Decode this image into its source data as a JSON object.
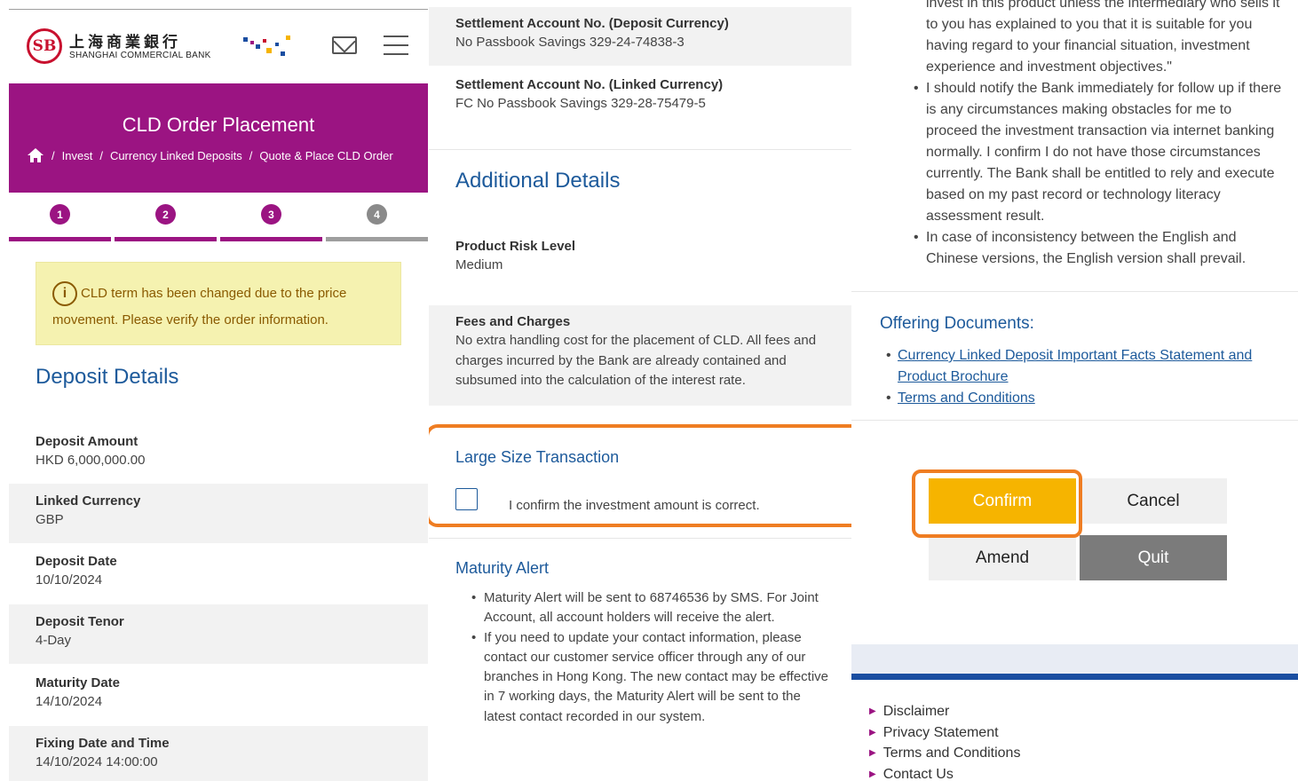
{
  "panel1": {
    "logo": {
      "seal": "SB",
      "chinese": "上海商業銀行",
      "english": "SHANGHAI COMMERCIAL BANK"
    },
    "banner": {
      "title": "CLD Order Placement"
    },
    "breadcrumb": [
      "Invest",
      "Currency Linked Deposits",
      "Quote & Place CLD Order"
    ],
    "steps": [
      "1",
      "2",
      "3",
      "4"
    ],
    "alert": {
      "text": "CLD term has been changed due to the price movement. Please verify the order information."
    },
    "section_title": "Deposit Details",
    "details": [
      {
        "label": "Deposit Amount",
        "value": "HKD  6,000,000.00"
      },
      {
        "label": "Linked Currency",
        "value": "GBP"
      },
      {
        "label": "Deposit Date",
        "value": "10/10/2024"
      },
      {
        "label": "Deposit Tenor",
        "value": "4-Day"
      },
      {
        "label": "Maturity Date",
        "value": "14/10/2024"
      },
      {
        "label": "Fixing Date and Time",
        "value": "14/10/2024 14:00:00"
      }
    ]
  },
  "panel2": {
    "settlement": [
      {
        "label": "Settlement Account No. (Deposit Currency)",
        "value": "No Passbook Savings 329-24-74838-3"
      },
      {
        "label": "Settlement Account No. (Linked Currency)",
        "value": "FC No Passbook Savings 329-28-75479-5"
      }
    ],
    "section_title": "Additional Details",
    "risk": {
      "label": "Product Risk Level",
      "value": "Medium"
    },
    "fees": {
      "label": "Fees and Charges",
      "value": "No extra handling cost for the placement of CLD. All fees and charges incurred by the Bank are already contained and subsumed into the calculation of the interest rate."
    },
    "large": {
      "title": "Large Size Transaction",
      "checkbox_label": "I confirm the investment amount is correct."
    },
    "maturity": {
      "title": "Maturity Alert",
      "items": [
        "Maturity Alert will be sent to 68746536 by SMS. For Joint Account, all account holders will receive the alert.",
        "If you need to update your contact information, please contact our customer service officer through any of our branches in Hong Kong. The new contact may be effective in 7 working days, the Maturity Alert will be sent to the latest contact recorded in our system."
      ]
    }
  },
  "panel3": {
    "terms_continued": "invest in this product unless the intermediary who sells it to you has explained to you that it is suitable for you having regard to your financial situation, investment experience and investment objectives.\"",
    "terms_items": [
      "I should notify the Bank immediately for follow up if there is any circumstances making obstacles for me to proceed the investment transaction via internet banking normally. I confirm I do not have those circumstances currently. The Bank shall be entitled to rely and execute based on my past record or technology literacy assessment result.",
      "In case of inconsistency between the English and Chinese versions, the English version shall prevail."
    ],
    "offering": {
      "title": "Offering Documents:",
      "links": [
        "Currency Linked Deposit Important Facts Statement and Product Brochure",
        "Terms and Conditions"
      ]
    },
    "buttons": {
      "confirm": "Confirm",
      "cancel": "Cancel",
      "amend": "Amend",
      "quit": "Quit"
    },
    "footer_links": [
      "Disclaimer",
      "Privacy Statement",
      "Terms and Conditions",
      "Contact Us"
    ]
  }
}
